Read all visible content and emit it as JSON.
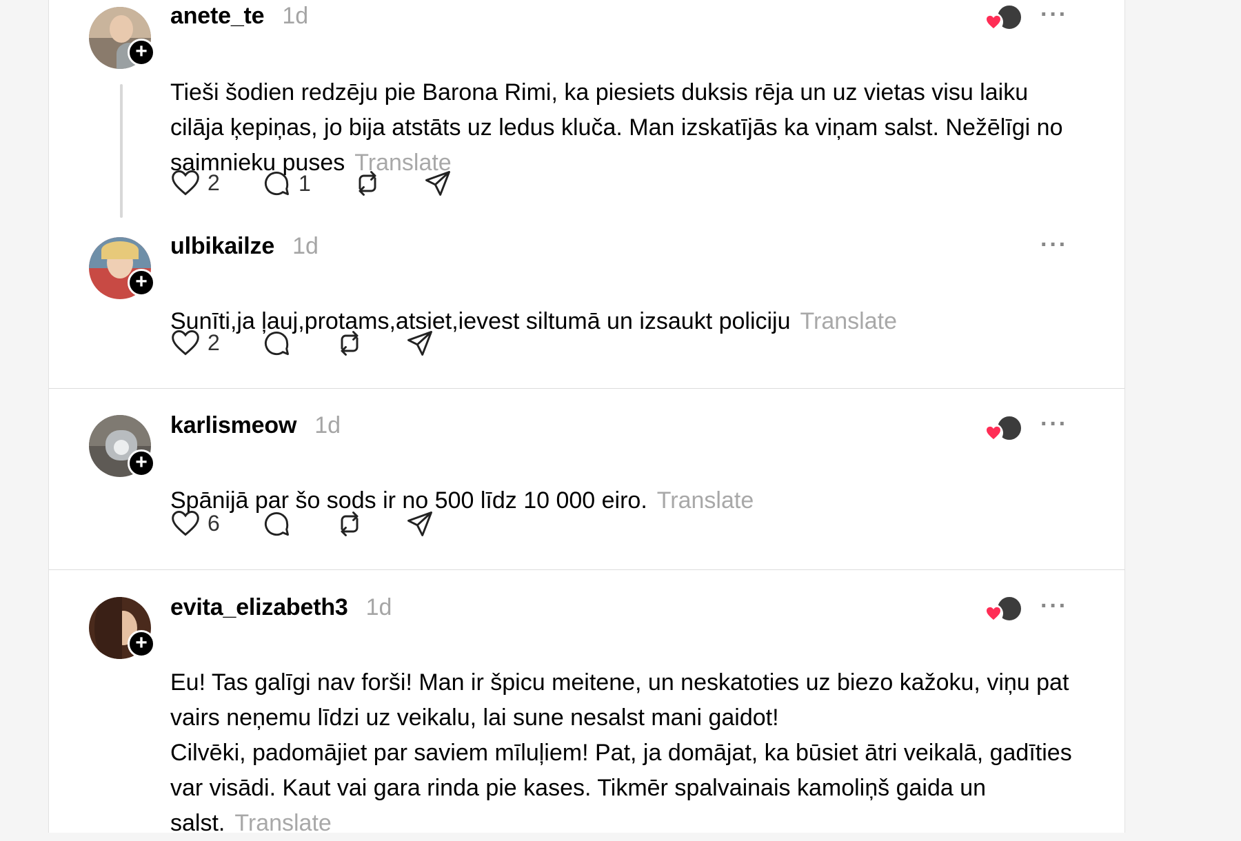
{
  "translate_label": "Translate",
  "colors": {
    "heart": "#ff2d55",
    "muted": "#a5a5a5",
    "divider": "#dcdcdc"
  },
  "posts": [
    {
      "username": "anete_te",
      "time": "1d",
      "text": "Tieši šodien redzēju pie Barona Rimi, ka piesiets duksis rēja un uz vietas visu laiku cilāja ķepiņas, jo bija atstāts uz ledus kluča. Man izskatījās ka viņam salst. Nežēlīgi no saimnieku puses",
      "likes": "2",
      "replies": "1",
      "has_reactions": true
    },
    {
      "username": "ulbikailze",
      "time": "1d",
      "text": "Sunīti,ja ļauj,protams,atsiet,ievest siltumā un izsaukt policiju",
      "likes": "2",
      "replies": "",
      "has_reactions": false
    },
    {
      "username": "karlismeow",
      "time": "1d",
      "text": "Spānijā par šo sods ir no 500 līdz 10 000 eiro.",
      "likes": "6",
      "replies": "",
      "has_reactions": true
    },
    {
      "username": "evita_elizabeth3",
      "time": "1d",
      "text": "Eu! Tas galīgi nav forši! Man ir špicu meitene, un neskatoties uz biezo kažoku, viņu pat vairs neņemu līdzi uz veikalu, lai sune nesalst mani gaidot!\nCilvēki, padomājiet par saviem mīluļiem! Pat, ja domājat, ka būsiet ātri veikalā, gadīties var visādi. Kaut vai gara rinda pie kases. Tikmēr spalvainais kamoliņš gaida un salst.",
      "likes": "",
      "replies": "",
      "has_reactions": true
    }
  ]
}
